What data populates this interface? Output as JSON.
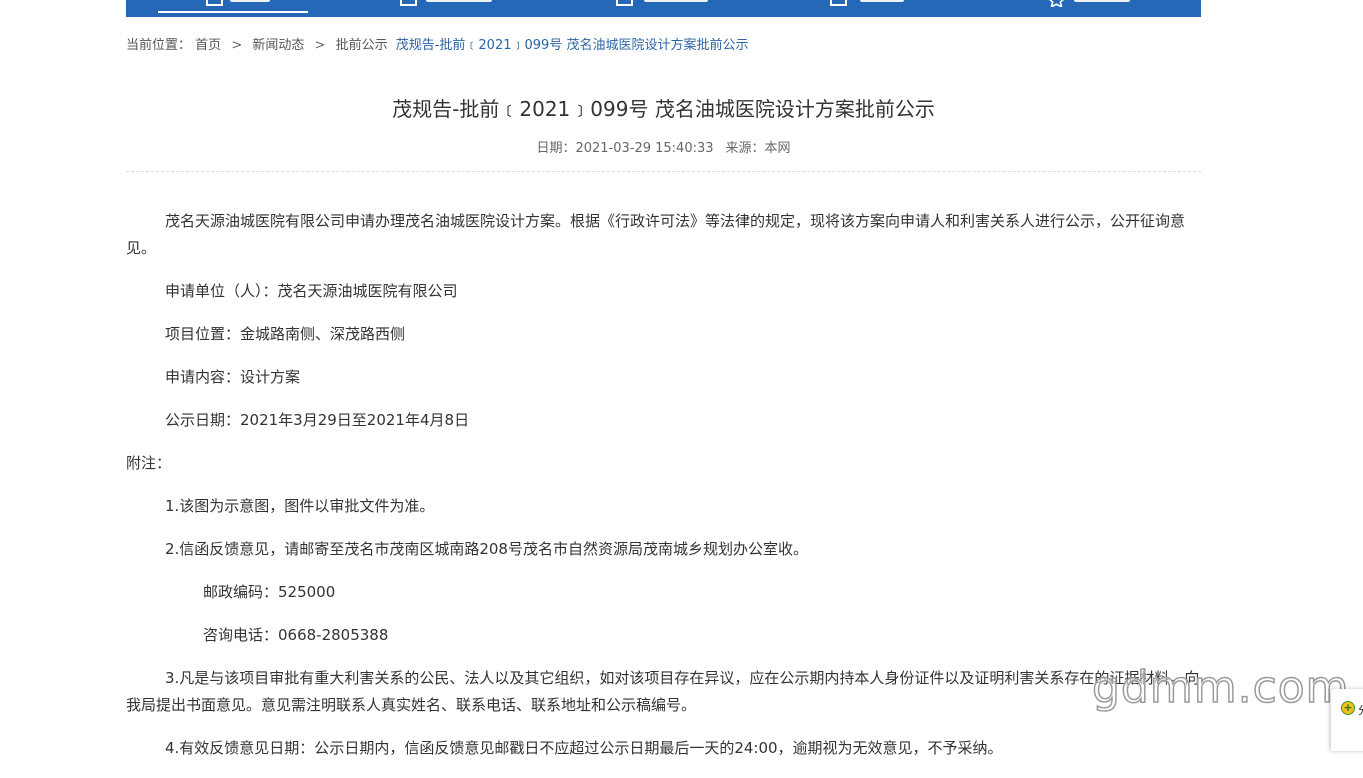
{
  "colors": {
    "nav_bg": "#2568b8",
    "link_current": "#2d63a6"
  },
  "nav": {
    "items": [
      {
        "icon": "home-icon"
      },
      {
        "icon": "document-icon"
      },
      {
        "icon": "building-icon"
      },
      {
        "icon": "notice-icon"
      },
      {
        "icon": "star-icon"
      }
    ]
  },
  "breadcrumb": {
    "prefix": "当前位置：",
    "home": "首页",
    "news": "新闻动态",
    "section": "批前公示",
    "current": "茂规告-批前﹝2021﹞099号 茂名油城医院设计方案批前公示",
    "separator": ">"
  },
  "article": {
    "title": "茂规告-批前﹝2021﹞099号 茂名油城医院设计方案批前公示",
    "date_label": "日期：",
    "date": "2021-03-29 15:40:33",
    "source_label": "来源：",
    "source": "本网",
    "intro": "茂名天源油城医院有限公司申请办理茂名油城医院设计方案。根据《行政许可法》等法律的规定，现将该方案向申请人和利害关系人进行公示，公开征询意见。",
    "applicant": "申请单位（人）：茂名天源油城医院有限公司",
    "location": "项目位置：金城路南侧、深茂路西侧",
    "content": "申请内容：设计方案",
    "period": "公示日期：2021年3月29日至2021年4月8日",
    "notes_label": "附注：",
    "note1": "1.该图为示意图，图件以审批文件为准。",
    "note2": "2.信函反馈意见，请邮寄至茂名市茂南区城南路208号茂名市自然资源局茂南城乡规划办公室收。",
    "postcode": "邮政编码：525000",
    "phone": "咨询电话：0668-2805388",
    "note3": "3.凡是与该项目审批有重大利害关系的公民、法人以及其它组织，如对该项目存在异议，应在公示期内持本人身份证件以及证明利害关系存在的证据材料，向我局提出书面意见。意见需注明联系人真实姓名、联系电话、联系地址和公示稿编号。",
    "note4": "4.有效反馈意见日期：公示日期内，信函反馈意见邮戳日不应超过公示日期最后一天的24:00，逾期视为无效意见，不予采纳。"
  },
  "watermark": {
    "text": "gdmm.com"
  },
  "side_widget": {
    "label": "分"
  }
}
